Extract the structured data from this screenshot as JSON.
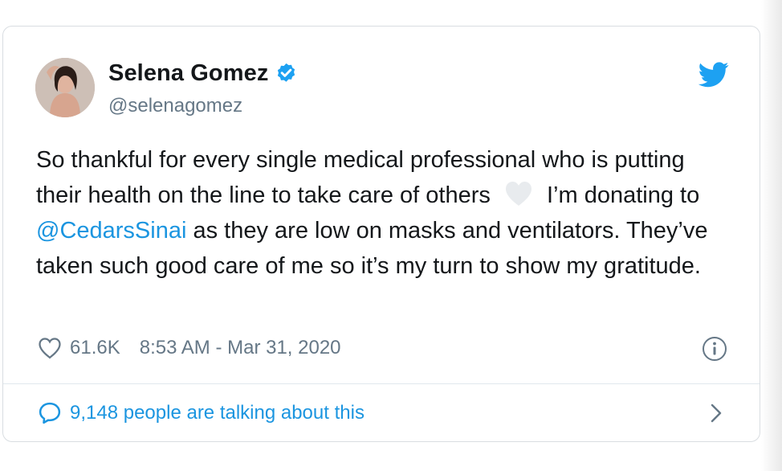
{
  "tweet": {
    "author_name": "Selena Gomez",
    "handle": "@selenagomez",
    "text_part1": "So thankful for every single medical professional who is putting their health on the line to take care of others",
    "emoji": "white-heart",
    "text_part2": "I’m donating to",
    "mention": "@CedarsSinai",
    "text_part3": "as they are low on masks and ventilators. They’ve taken such good care of me so it’s my turn to show my gratitude.",
    "likes": "61.6K",
    "timestamp": "8:53 AM - Mar 31, 2020",
    "conversation": "9,148 people are talking about this"
  },
  "icons": {
    "verified": "verified-badge-icon",
    "brand": "twitter-bird-icon",
    "like": "heart-outline-icon",
    "info": "info-icon",
    "reply": "speech-bubble-icon",
    "chevron": "chevron-right-icon"
  },
  "colors": {
    "brand": "#1da1f2",
    "link": "#1b95e0",
    "text": "#14171a",
    "secondary": "#657786"
  }
}
